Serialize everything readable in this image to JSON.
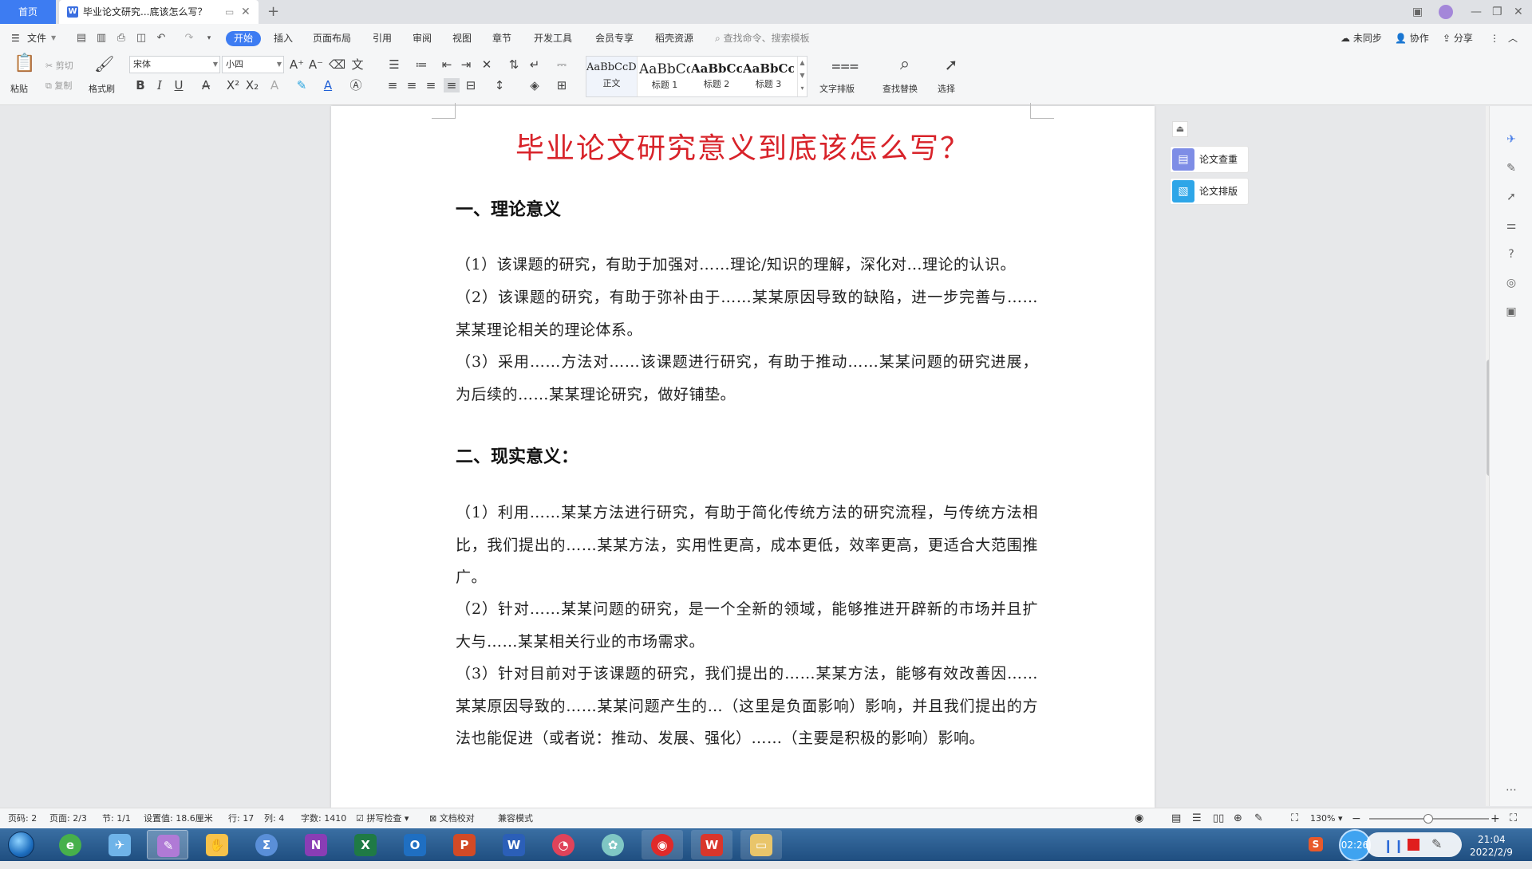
{
  "tabs": {
    "home_label": "首页",
    "doc_label": "毕业论文研究...底该怎么写？",
    "add_label": "+"
  },
  "menu": {
    "file": "文件",
    "items": [
      "开始",
      "插入",
      "页面布局",
      "引用",
      "审阅",
      "视图",
      "章节",
      "开发工具",
      "会员专享",
      "稻壳资源"
    ],
    "search_placeholder": "查找命令、搜索模板",
    "sync": "未同步",
    "collab": "协作",
    "share": "分享"
  },
  "ribbon": {
    "paste": "粘贴",
    "cut": "剪切",
    "copy": "复制",
    "format_painter": "格式刷",
    "font_name": "宋体",
    "font_size": "小四",
    "styles": [
      {
        "sample": "AaBbCcDd",
        "name": "正文"
      },
      {
        "sample": "AaBbCc",
        "name": "标题 1"
      },
      {
        "sample": "AaBbCcI",
        "name": "标题 2"
      },
      {
        "sample": "AaBbCcI",
        "name": "标题 3"
      }
    ],
    "text_layout": "文字排版",
    "find_replace": "查找替换",
    "select": "选择"
  },
  "document": {
    "title": "毕业论文研究意义到底该怎么写？",
    "section1_heading": "一、理论意义",
    "section1_paragraphs": [
      "（1）该课题的研究，有助于加强对……理论/知识的理解，深化对…理论的认识。",
      "（2）该课题的研究，有助于弥补由于……某某原因导致的缺陷，进一步完善与……某某理论相关的理论体系。",
      "（3）采用……方法对……该课题进行研究，有助于推动……某某问题的研究进展，为后续的……某某理论研究，做好铺垫。"
    ],
    "section2_heading": "二、现实意义：",
    "section2_paragraphs": [
      "（1）利用……某某方法进行研究，有助于简化传统方法的研究流程，与传统方法相比，我们提出的……某某方法，实用性更高，成本更低，效率更高，更适合大范围推广。",
      "（2）针对……某某问题的研究，是一个全新的领域，能够推进开辟新的市场并且扩大与……某某相关行业的市场需求。",
      "（3）针对目前对于该课题的研究，我们提出的……某某方法，能够有效改善因……某某原因导致的……某某问题产生的…（这里是负面影响）影响，并且我们提出的方法也能促进（或者说：推动、发展、强化）……（主要是积极的影响）影响。"
    ]
  },
  "side_panel": {
    "check": "论文查重",
    "layout": "论文排版"
  },
  "status": {
    "page_num": "页码: 2",
    "pages": "页面: 2/3",
    "section": "节: 1/1",
    "setting": "设置值: 18.6厘米",
    "row": "行: 17",
    "col": "列: 4",
    "words": "字数: 1410",
    "spell": "拼写检查",
    "proof": "文档校对",
    "compat": "兼容模式",
    "zoom": "130%"
  },
  "taskbar": {
    "timer": "02:26",
    "time": "21:04",
    "date": "2022/2/9"
  },
  "colors": {
    "accent": "#3d7cf2",
    "title_red": "#d8232a"
  }
}
